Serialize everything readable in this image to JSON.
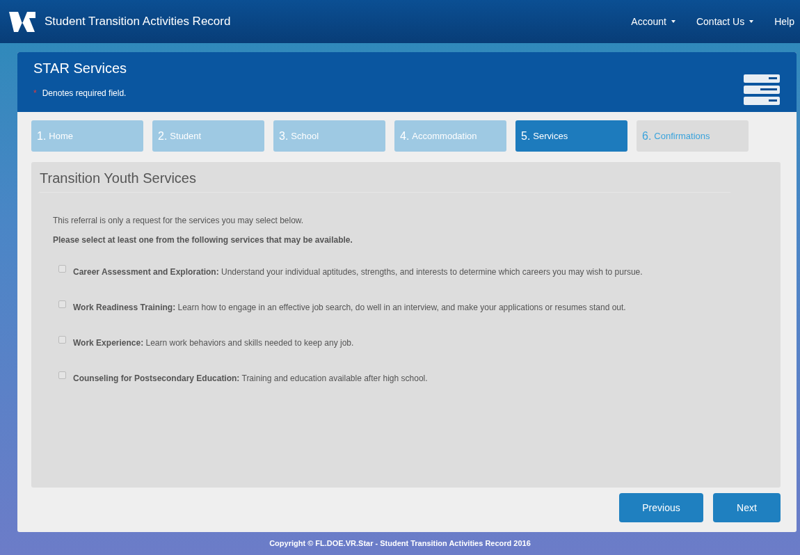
{
  "navbar": {
    "brand": "Student Transition Activities Record",
    "menus": [
      {
        "label": "Account",
        "dropdown": true
      },
      {
        "label": "Contact Us",
        "dropdown": true
      },
      {
        "label": "Help",
        "dropdown": false
      }
    ]
  },
  "header": {
    "title": "STAR Services",
    "required_mark": "*",
    "required_note": "Denotes required field."
  },
  "steps": [
    {
      "number": "1.",
      "label": "Home",
      "selected": false,
      "disabled": false
    },
    {
      "number": "2.",
      "label": "Student",
      "selected": false,
      "disabled": false
    },
    {
      "number": "3.",
      "label": "School",
      "selected": false,
      "disabled": false
    },
    {
      "number": "4.",
      "label": "Accommodation",
      "selected": false,
      "disabled": false
    },
    {
      "number": "5.",
      "label": "Services",
      "selected": true,
      "disabled": false
    },
    {
      "number": "6.",
      "label": "Confirmations",
      "selected": false,
      "disabled": true
    }
  ],
  "panel": {
    "title": "Transition Youth Services",
    "intro": "This referral is only a request for the services you may select below.",
    "instruction": "Please select at least one from the following services that may be available.",
    "services": [
      {
        "text": "**Career Assessment and Exploration:** Understand your individual aptitudes, strengths, and interests to determine which careers you may wish to pursue.",
        "checked": false
      },
      {
        "text": "**Work Readiness Training:** Learn how to engage in an effective job search, do well in an interview, and make your applications or resumes stand out.",
        "checked": false
      },
      {
        "text": "**Work Experience:** Learn work behaviors and skills needed to keep any job.",
        "checked": false
      },
      {
        "text": "**Counseling for Postsecondary Education:** Training and education available after high school.",
        "checked": false
      }
    ]
  },
  "buttons": [
    "Previous",
    "Next"
  ],
  "footer": "Copyright © FL.DOE.VR.Star - Student Transition Activities Record 2016"
}
